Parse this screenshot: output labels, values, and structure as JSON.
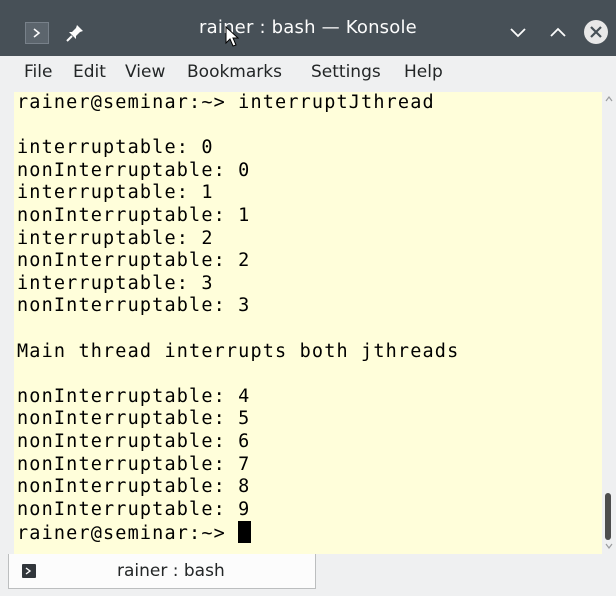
{
  "window": {
    "title": "rainer : bash — Konsole"
  },
  "menubar": {
    "items": [
      "File",
      "Edit",
      "View",
      "Bookmarks",
      "Settings",
      "Help"
    ]
  },
  "terminal": {
    "lines": [
      "rainer@seminar:~> interruptJthread",
      "",
      "interruptable: 0",
      "nonInterruptable: 0",
      "interruptable: 1",
      "nonInterruptable: 1",
      "interruptable: 2",
      "nonInterruptable: 2",
      "interruptable: 3",
      "nonInterruptable: 3",
      "",
      "Main thread interrupts both jthreads",
      "",
      "nonInterruptable: 4",
      "nonInterruptable: 5",
      "nonInterruptable: 6",
      "nonInterruptable: 7",
      "nonInterruptable: 8",
      "nonInterruptable: 9"
    ],
    "prompt": "rainer@seminar:~> "
  },
  "tabs": [
    {
      "label": "rainer : bash"
    }
  ],
  "colors": {
    "titlebar": "#475057",
    "terminal_bg": "#fffeda",
    "terminal_fg": "#000000",
    "close_button": "#e8e8e8"
  }
}
